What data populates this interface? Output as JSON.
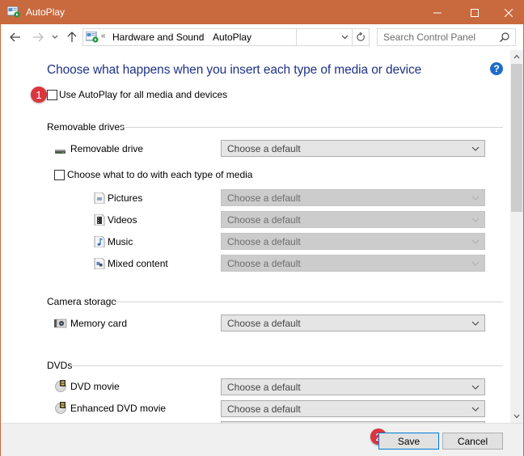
{
  "window": {
    "title": "AutoPlay",
    "controls": {
      "minimize": "—",
      "maximize": "☐",
      "close": "✕"
    }
  },
  "nav": {
    "back_icon": "←",
    "forward_icon": "→",
    "recent_icon": "˅",
    "up_icon": "↑",
    "breadcrumb_overflow": "«",
    "breadcrumb": [
      "Hardware and Sound",
      "AutoPlay"
    ],
    "breadcrumb_separator": "›",
    "dropdown_icon": "˅",
    "refresh_icon": "↻",
    "search_placeholder": "Search Control Panel"
  },
  "page": {
    "title": "Choose what happens when you insert each type of media or device",
    "help_icon": "?",
    "use_autoplay_label": "Use AutoPlay for all media and devices",
    "use_autoplay_checked": false,
    "annotation_1": "1",
    "annotation_2": "2"
  },
  "sections": {
    "removable": {
      "header": "Removable drives",
      "drive_label": "Removable drive",
      "drive_value": "Choose a default",
      "per_media_label": "Choose what to do with each type of media",
      "per_media_checked": false,
      "media": [
        {
          "label": "Pictures",
          "value": "Choose a default",
          "enabled": false
        },
        {
          "label": "Videos",
          "value": "Choose a default",
          "enabled": false
        },
        {
          "label": "Music",
          "value": "Choose a default",
          "enabled": false
        },
        {
          "label": "Mixed content",
          "value": "Choose a default",
          "enabled": false
        }
      ]
    },
    "camera": {
      "header": "Camera storage",
      "items": [
        {
          "label": "Memory card",
          "value": "Choose a default"
        }
      ]
    },
    "dvds": {
      "header": "DVDs",
      "items": [
        {
          "label": "DVD movie",
          "value": "Choose a default"
        },
        {
          "label": "Enhanced DVD movie",
          "value": "Choose a default"
        }
      ]
    }
  },
  "footer": {
    "save_label": "Save",
    "cancel_label": "Cancel"
  },
  "colors": {
    "titlebar": "#c9693e",
    "heading": "#1e3287",
    "badge": "#d9363e",
    "help": "#1f6cc7",
    "focus": "#0078d7"
  }
}
